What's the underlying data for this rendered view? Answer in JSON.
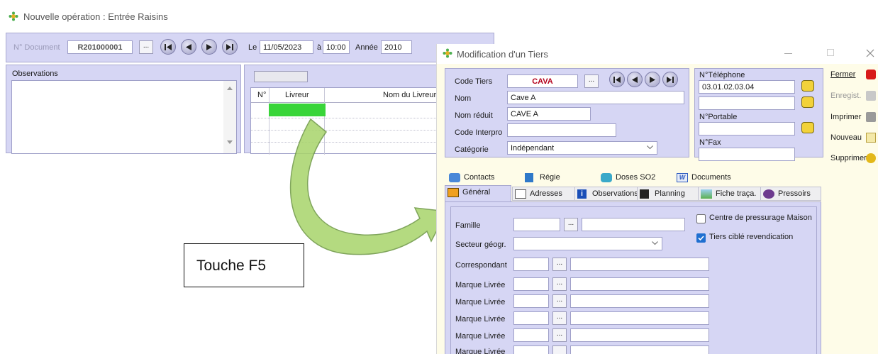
{
  "bg_window": {
    "title": "Nouvelle opération : Entrée Raisins",
    "doc_label": "N° Document",
    "doc_number": "R201000001",
    "dots": "...",
    "date_label": "Le",
    "date_value": "11/05/2023",
    "time_sep": "à",
    "time_value": "10:00",
    "year_label": "Année",
    "year_value": "2010",
    "observations_label": "Observations",
    "grid_headers": [
      "N°",
      "Livreur",
      "Nom du Livreur"
    ]
  },
  "annotation": {
    "text": "Touche F5"
  },
  "dialog": {
    "title": "Modification d'un Tiers",
    "fields": {
      "code_tiers_label": "Code Tiers",
      "code_tiers_value": "CAVA",
      "nom_label": "Nom",
      "nom_value": "Cave A",
      "nom_reduit_label": "Nom réduit",
      "nom_reduit_value": "CAVE A",
      "code_interpro_label": "Code Interpro",
      "code_interpro_value": "",
      "categorie_label": "Catégorie",
      "categorie_value": "Indépendant",
      "dots": "..."
    },
    "phone": {
      "telephone_label": "N°Téléphone",
      "telephone_value": "03.01.02.03.04",
      "portable_label": "N°Portable",
      "fax_label": "N°Fax"
    },
    "tabs_row1": [
      "Contacts",
      "Régie",
      "Doses SO2",
      "Documents"
    ],
    "tabs_row2": [
      "Général",
      "Adresses",
      "Observations",
      "Planning",
      "Fiche traça.",
      "Pressoirs"
    ],
    "general": {
      "famille_label": "Famille",
      "secteur_label": "Secteur géogr.",
      "correspondant_label": "Correspondant",
      "marque_labels": [
        "Marque Livrée",
        "Marque Livrée",
        "Marque Livrée",
        "Marque Livrée",
        "Marque Livrée"
      ],
      "centre_label": "Centre de pressurage Maison",
      "centre_checked": false,
      "cible_label": "Tiers ciblé revendication",
      "cible_checked": true
    },
    "side_buttons": [
      "Fermer",
      "Enregist.",
      "Imprimer",
      "Nouveau",
      "Supprimer"
    ]
  },
  "colors": {
    "panel": "#d6d6f4",
    "highlight_cell": "#39d539",
    "code_tiers_text": "#b3001b",
    "arrow_fill": "#a8d46a"
  }
}
